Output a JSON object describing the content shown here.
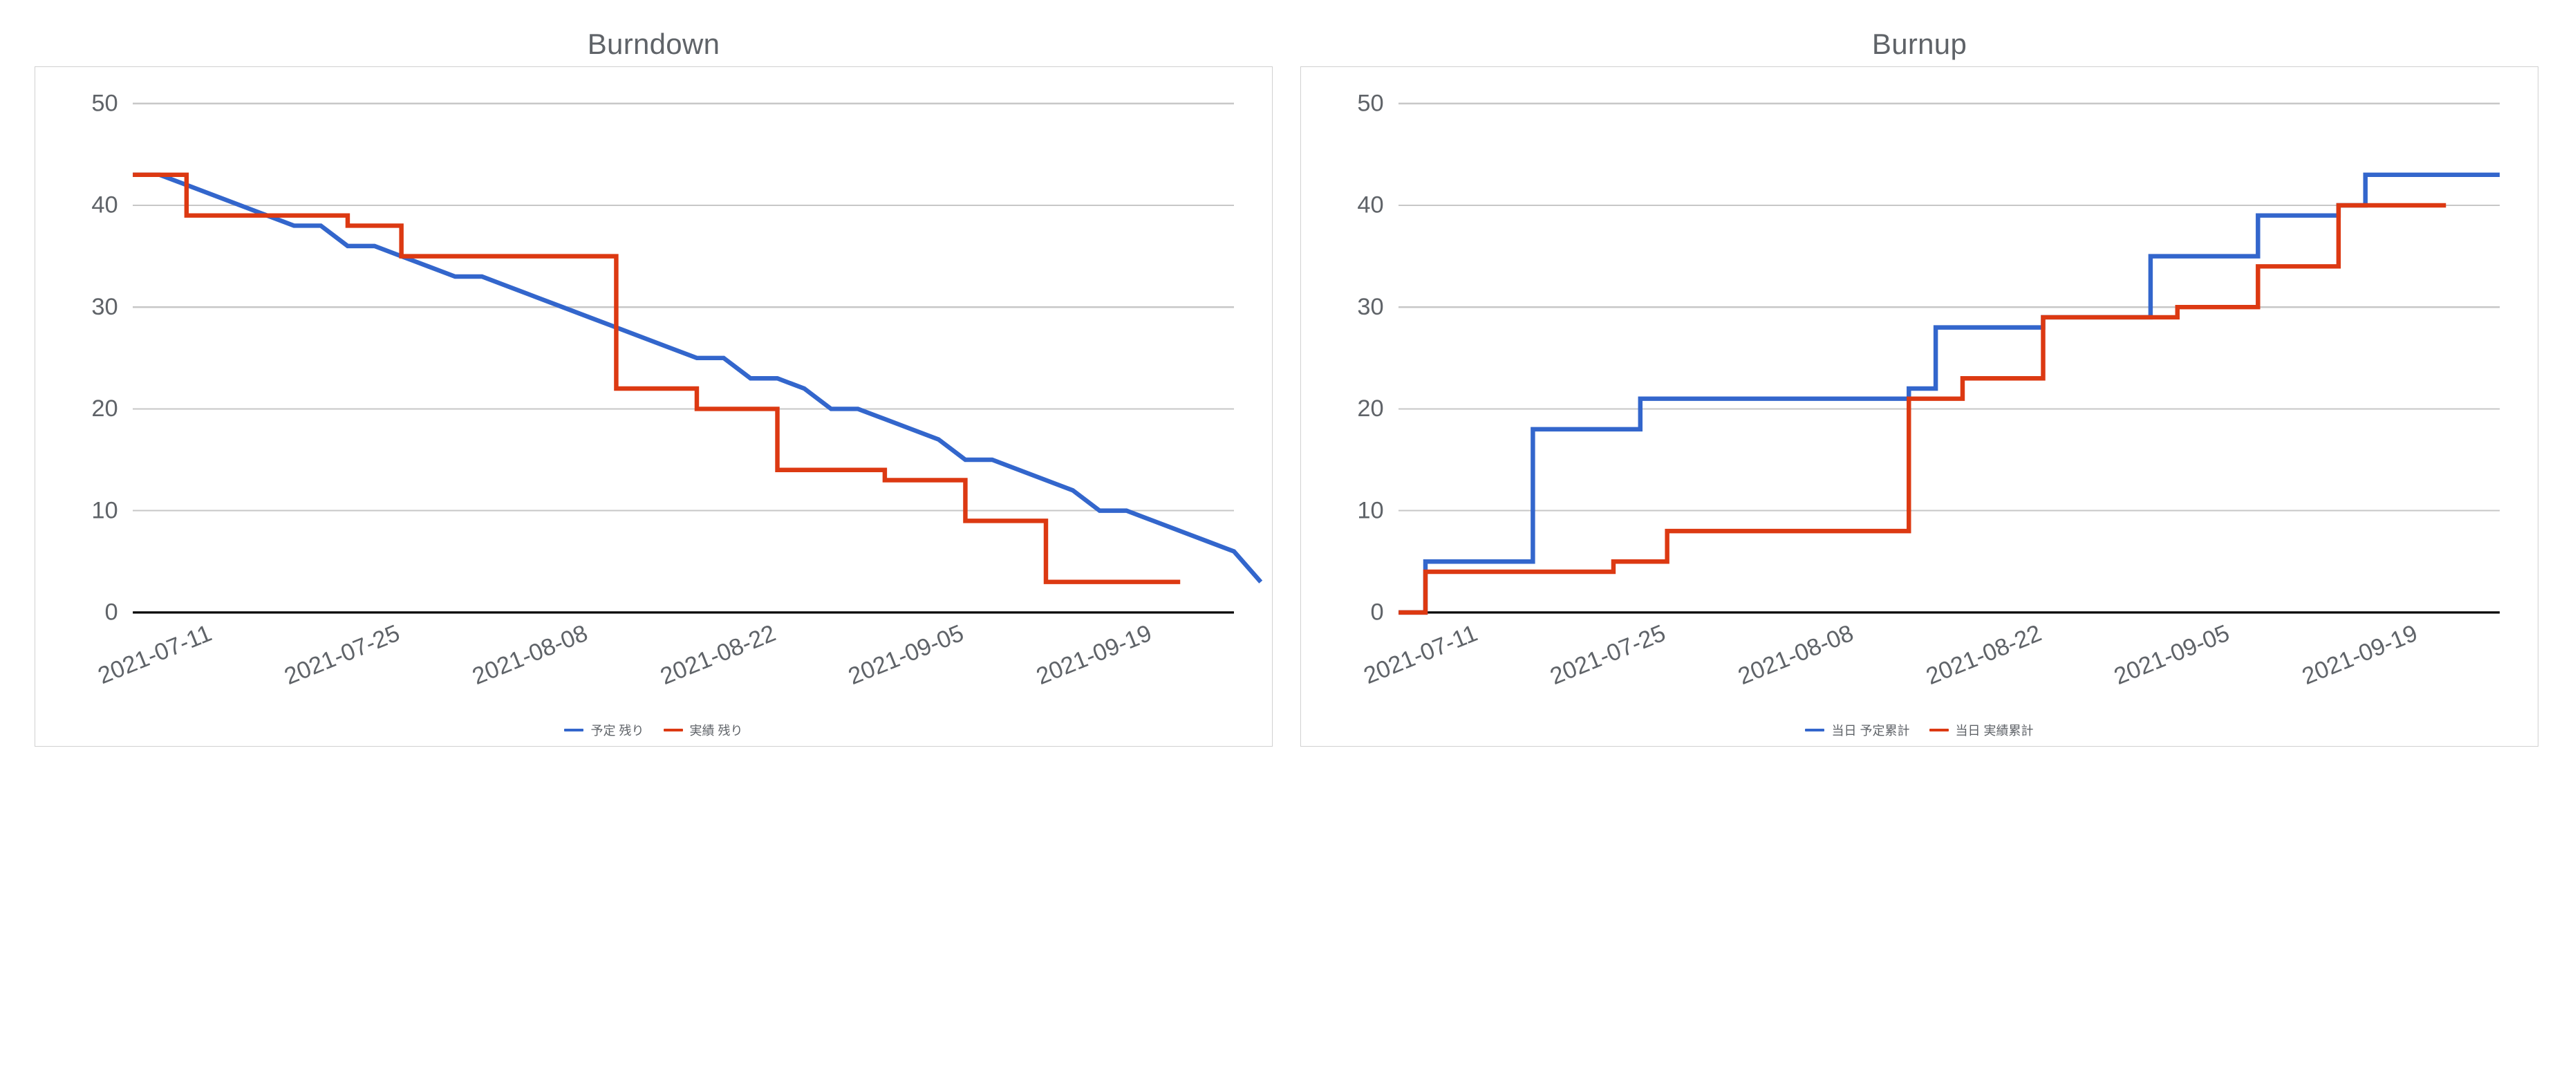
{
  "colors": {
    "series_a": "#3366cc",
    "series_b": "#dc3912",
    "grid": "#c7c7c7",
    "axis": "#000000",
    "text": "#5f6368"
  },
  "chart_data": [
    {
      "id": "burndown",
      "type": "line",
      "title": "Burndown",
      "xlabel": "",
      "ylabel": "",
      "ylim": [
        0,
        50
      ],
      "ytick": 10,
      "x_tick_labels": [
        "2021-07-11",
        "2021-07-25",
        "2021-08-08",
        "2021-08-22",
        "2021-09-05",
        "2021-09-19"
      ],
      "x_tick_indices": [
        3,
        10,
        17,
        24,
        31,
        38
      ],
      "x_count": 42,
      "legend_position": "bottom",
      "series": [
        {
          "name": "予定 残り",
          "color_key": "series_a",
          "step": false,
          "values": [
            43,
            43,
            42,
            41,
            40,
            39,
            38,
            38,
            36,
            36,
            35,
            34,
            33,
            33,
            32,
            31,
            30,
            29,
            28,
            27,
            26,
            25,
            25,
            23,
            23,
            22,
            20,
            20,
            19,
            18,
            17,
            15,
            15,
            14,
            13,
            12,
            10,
            10,
            9,
            8,
            7,
            6,
            3
          ]
        },
        {
          "name": "実績 残り",
          "color_key": "series_b",
          "step": true,
          "values": [
            43,
            43,
            39,
            39,
            39,
            39,
            39,
            39,
            38,
            38,
            35,
            35,
            35,
            35,
            35,
            35,
            35,
            35,
            22,
            22,
            22,
            20,
            20,
            20,
            14,
            14,
            14,
            14,
            13,
            13,
            13,
            9,
            9,
            9,
            3,
            3,
            3,
            3,
            3,
            3
          ]
        }
      ]
    },
    {
      "id": "burnup",
      "type": "line",
      "title": "Burnup",
      "xlabel": "",
      "ylabel": "",
      "ylim": [
        0,
        50
      ],
      "ytick": 10,
      "x_tick_labels": [
        "2021-07-11",
        "2021-07-25",
        "2021-08-08",
        "2021-08-22",
        "2021-09-05",
        "2021-09-19"
      ],
      "x_tick_indices": [
        3,
        10,
        17,
        24,
        31,
        38
      ],
      "x_count": 42,
      "legend_position": "bottom",
      "series": [
        {
          "name": "当日 予定累計",
          "color_key": "series_a",
          "step": true,
          "values": [
            0,
            5,
            5,
            5,
            5,
            18,
            18,
            18,
            18,
            21,
            21,
            21,
            21,
            21,
            21,
            21,
            21,
            21,
            21,
            22,
            28,
            28,
            28,
            28,
            29,
            29,
            29,
            29,
            35,
            35,
            35,
            35,
            39,
            39,
            39,
            40,
            43,
            43,
            43,
            43,
            43,
            43
          ]
        },
        {
          "name": "当日 実績累計",
          "color_key": "series_b",
          "step": true,
          "values": [
            0,
            4,
            4,
            4,
            4,
            4,
            4,
            4,
            5,
            5,
            8,
            8,
            8,
            8,
            8,
            8,
            8,
            8,
            8,
            21,
            21,
            23,
            23,
            23,
            29,
            29,
            29,
            29,
            29,
            30,
            30,
            30,
            34,
            34,
            34,
            40,
            40,
            40,
            40,
            40
          ]
        }
      ]
    }
  ]
}
